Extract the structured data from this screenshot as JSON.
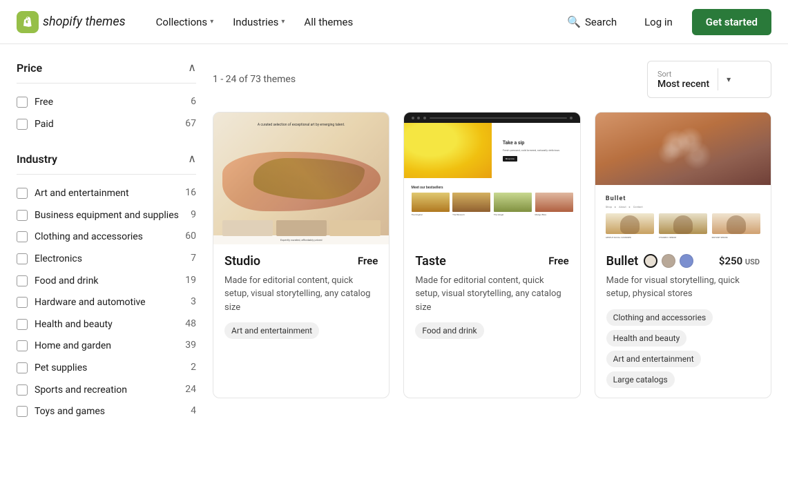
{
  "header": {
    "logo_text": "shopify",
    "logo_suffix": "themes",
    "nav": [
      {
        "label": "Collections",
        "has_dropdown": true
      },
      {
        "label": "Industries",
        "has_dropdown": true
      },
      {
        "label": "All themes",
        "has_dropdown": false
      }
    ],
    "search_label": "Search",
    "login_label": "Log in",
    "get_started_label": "Get started"
  },
  "sidebar": {
    "price_section": {
      "title": "Price",
      "items": [
        {
          "label": "Free",
          "count": "6"
        },
        {
          "label": "Paid",
          "count": "67"
        }
      ]
    },
    "industry_section": {
      "title": "Industry",
      "items": [
        {
          "label": "Art and entertainment",
          "count": "16"
        },
        {
          "label": "Business equipment and supplies",
          "count": "9"
        },
        {
          "label": "Clothing and accessories",
          "count": "60"
        },
        {
          "label": "Electronics",
          "count": "7"
        },
        {
          "label": "Food and drink",
          "count": "19"
        },
        {
          "label": "Hardware and automotive",
          "count": "3"
        },
        {
          "label": "Health and beauty",
          "count": "48"
        },
        {
          "label": "Home and garden",
          "count": "39"
        },
        {
          "label": "Pet supplies",
          "count": "2"
        },
        {
          "label": "Sports and recreation",
          "count": "24"
        },
        {
          "label": "Toys and games",
          "count": "4"
        }
      ]
    }
  },
  "content": {
    "results_text": "1 - 24 of 73 themes",
    "sort": {
      "label": "Sort",
      "value": "Most recent"
    },
    "themes": [
      {
        "name": "Studio",
        "price": "Free",
        "price_type": "free",
        "description": "Made for editorial content, quick setup, visual storytelling, any catalog size",
        "tags": [
          "Art and entertainment"
        ],
        "has_swatches": false
      },
      {
        "name": "Taste",
        "price": "Free",
        "price_type": "free",
        "description": "Made for editorial content, quick setup, visual storytelling, any catalog size",
        "tags": [
          "Food and drink"
        ],
        "has_swatches": false
      },
      {
        "name": "Bullet",
        "price": "$250",
        "price_note": "USD",
        "price_type": "paid",
        "description": "Made for visual storytelling, quick setup, physical stores",
        "tags": [
          "Clothing and accessories",
          "Health and beauty",
          "Art and entertainment",
          "Large catalogs"
        ],
        "has_swatches": true,
        "swatches": [
          {
            "color": "#e8e0d4",
            "selected": true
          },
          {
            "color": "#b8a898",
            "selected": false
          },
          {
            "color": "#7b8fcf",
            "selected": false
          }
        ]
      }
    ]
  }
}
